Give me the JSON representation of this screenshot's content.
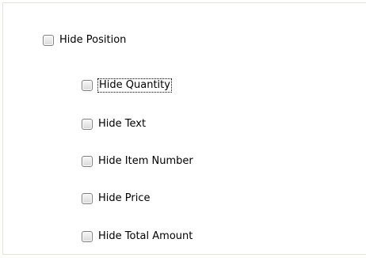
{
  "options": {
    "hide_position": {
      "label": "Hide Position",
      "checked": false
    },
    "children": [
      {
        "key": "hide-quantity",
        "label": "Hide Quantity",
        "checked": false,
        "focused": true
      },
      {
        "key": "hide-text",
        "label": "Hide Text",
        "checked": false
      },
      {
        "key": "hide-item-number",
        "label": "Hide Item Number",
        "checked": false
      },
      {
        "key": "hide-price",
        "label": "Hide Price",
        "checked": false
      },
      {
        "key": "hide-total-amount",
        "label": "Hide Total Amount",
        "checked": false
      }
    ]
  },
  "colors": {
    "panel_border": "#e6e4d3",
    "checkbox_border": "#7f7f7f",
    "focus_outline": "#000000"
  }
}
